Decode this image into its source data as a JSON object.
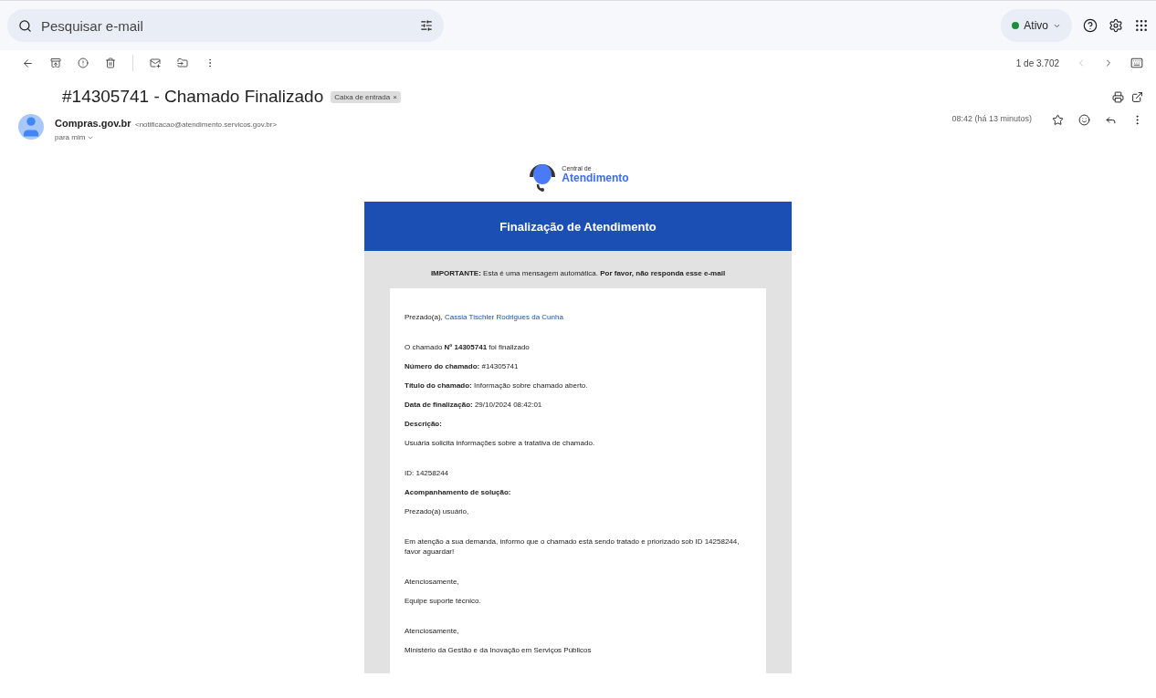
{
  "search": {
    "placeholder": "Pesquisar e-mail"
  },
  "status": {
    "label": "Ativo"
  },
  "pager": {
    "text": "1 de 3.702",
    "prev": {
      "disabled": true
    },
    "next": {
      "disabled": false
    }
  },
  "subject": {
    "title": "#14305741 - Chamado Finalizado",
    "label": "Caixa de entrada",
    "label_close": "×"
  },
  "sender": {
    "name": "Compras.gov.br",
    "address": "<notificacao@atendimento.servicos.gov.br>",
    "to": "para mim",
    "time": "08:42 (há 13 minutos)"
  },
  "logo": {
    "line_1": "Central de",
    "line_2": "Atendimento"
  },
  "banner": {
    "title": "Finalização de Atendimento"
  },
  "notice": "**IMPORTANTE:** Esta é uma mensagem automática. **Por favor, não responda esse e-mail**",
  "greeting": {
    "prefix": "Prezado(a),",
    "name": "Cassia Tischler Rodrigues da Cunha"
  },
  "body": [
    {
      "kind": "spaced",
      "text": "O chamado **Nº 14305741** foi finalizado"
    },
    {
      "kind": "line",
      "text": "**Número do chamado:** #14305741"
    },
    {
      "kind": "line",
      "text": "**Título do chamado:** Informação sobre chamado aberto."
    },
    {
      "kind": "line",
      "text": "**Data de finalização:** 29/10/2024 08:42:01"
    },
    {
      "kind": "line",
      "text": "**Descrição:**"
    },
    {
      "kind": "line",
      "text": "Usuária solicita informações sobre a tratativa de chamado."
    },
    {
      "kind": "spaced",
      "text": "ID: 14258244"
    },
    {
      "kind": "line",
      "text": "**Acompanhamento de solução:**"
    },
    {
      "kind": "line",
      "text": "Prezado(a) usuário,"
    },
    {
      "kind": "spaced",
      "text": "Em atenção a sua demanda, informo que o chamado está sendo tratado e priorizado sob ID 14258244, favor aguardar!"
    },
    {
      "kind": "spaced",
      "text": "Atenciosamente,"
    },
    {
      "kind": "line",
      "text": "Equipe suporte técnico."
    },
    {
      "kind": "spaced",
      "text": "Atenciosamente,"
    },
    {
      "kind": "line",
      "text": "Ministério da Gestão e da Inovação em Serviços Públicos"
    }
  ]
}
